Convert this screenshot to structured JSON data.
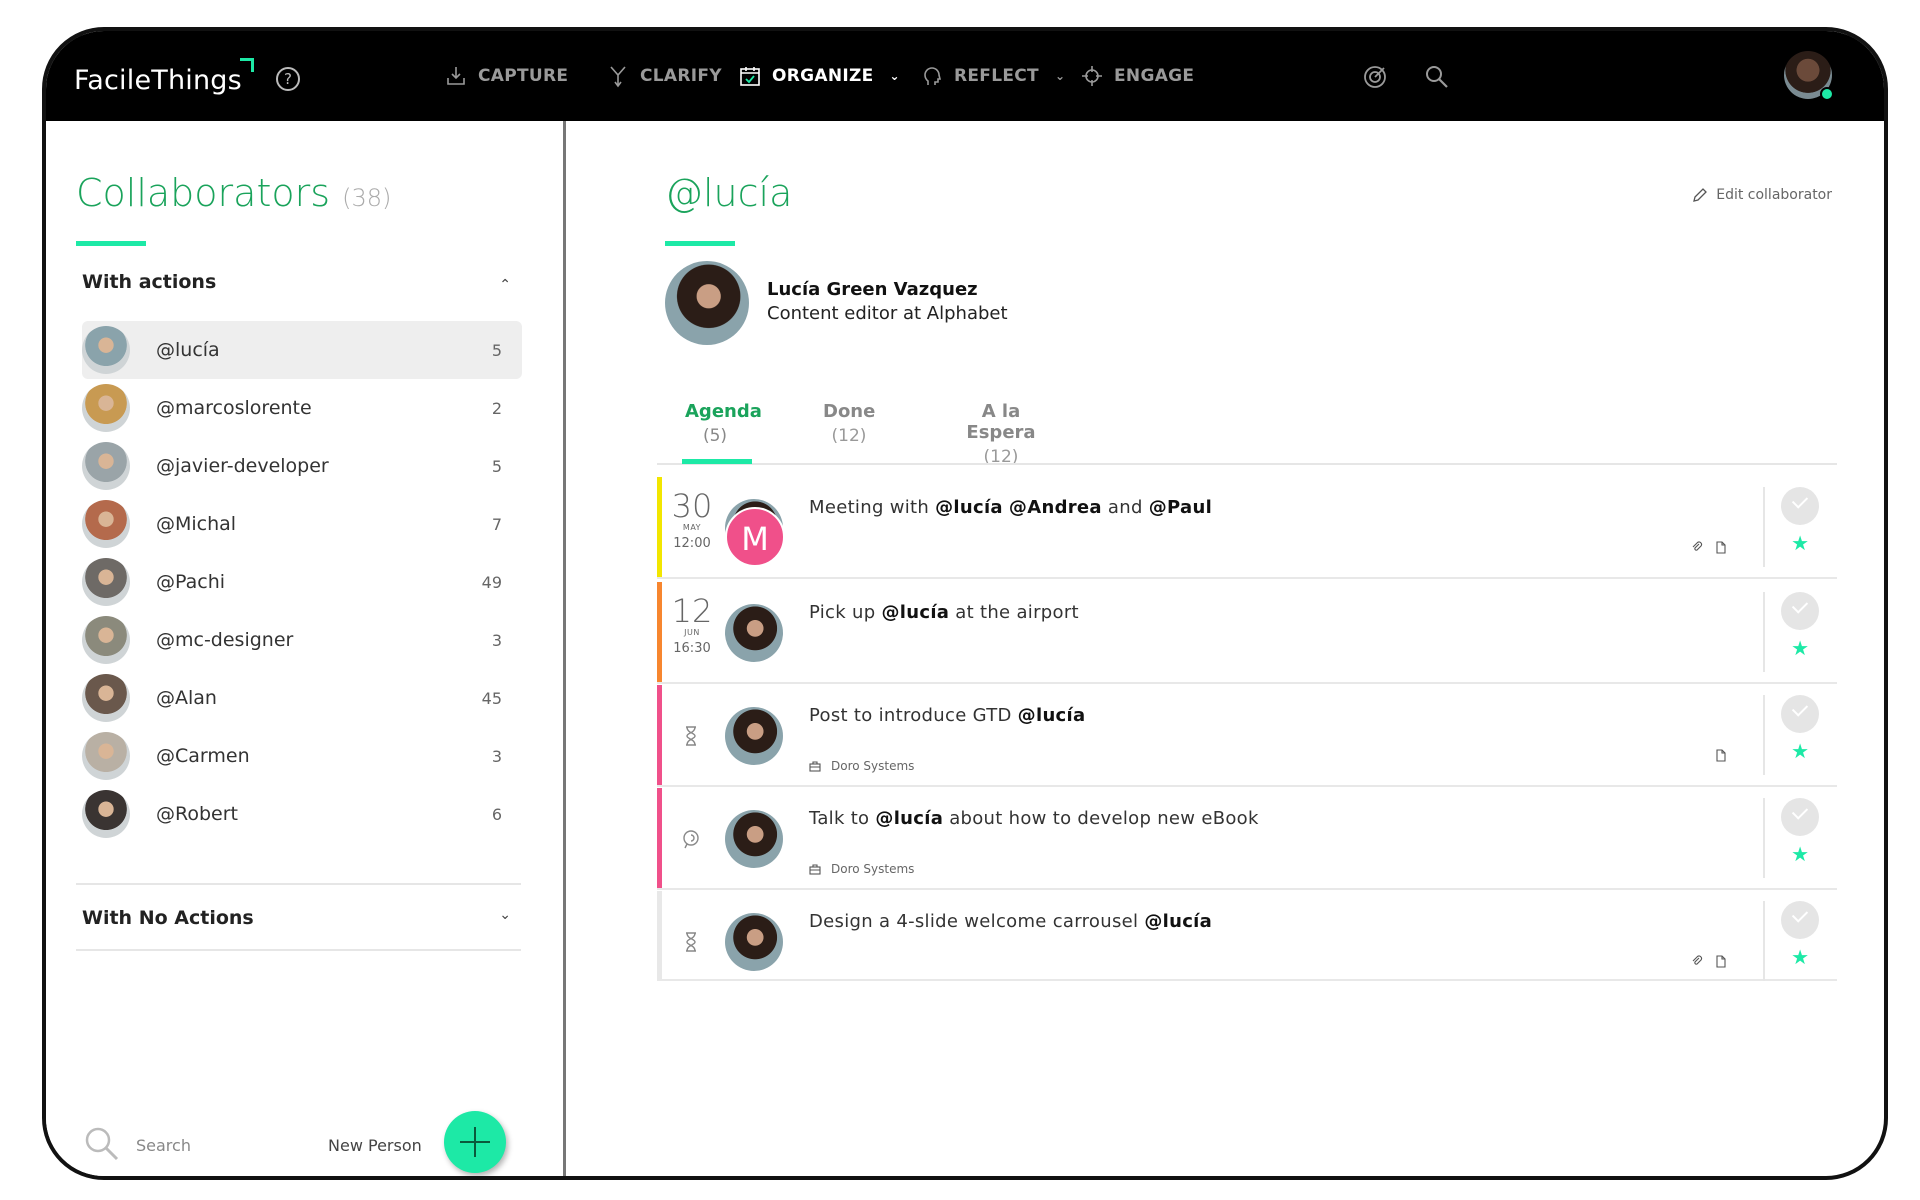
{
  "app": {
    "logo": "FacileThings"
  },
  "nav": [
    {
      "label": "CAPTURE",
      "icon": "inbox-download-icon",
      "active": false
    },
    {
      "label": "CLARIFY",
      "icon": "clarify-fork-icon",
      "active": false
    },
    {
      "label": "ORGANIZE",
      "icon": "calendar-check-icon",
      "active": true,
      "dropdown": true
    },
    {
      "label": "REFLECT",
      "icon": "head-icon",
      "active": false,
      "dropdown": true
    },
    {
      "label": "ENGAGE",
      "icon": "crosshair-icon",
      "active": false
    }
  ],
  "left": {
    "title": "Collaborators",
    "count": "(38)",
    "section_with_actions": "With actions",
    "section_no_actions": "With No Actions",
    "people": [
      {
        "name": "@lucía",
        "count": "5",
        "selected": true,
        "color": "#8aa3ab"
      },
      {
        "name": "@marcoslorente",
        "count": "2",
        "color": "#c89a52"
      },
      {
        "name": "@javier-developer",
        "count": "5",
        "color": "#9aa4a8"
      },
      {
        "name": "@Michal",
        "count": "7",
        "color": "#b46a4c"
      },
      {
        "name": "@Pachi",
        "count": "49",
        "color": "#6e6a66"
      },
      {
        "name": "@mc-designer",
        "count": "3",
        "color": "#8b8a7c"
      },
      {
        "name": "@Alan",
        "count": "45",
        "color": "#6a584c"
      },
      {
        "name": "@Carmen",
        "count": "3",
        "color": "#b9b0a4"
      },
      {
        "name": "@Robert",
        "count": "6",
        "color": "#3a3432"
      }
    ],
    "search_label": "Search",
    "new_person_label": "New Person"
  },
  "main": {
    "handle": "@lucía",
    "edit_label": "Edit collaborator",
    "profile_name": "Lucía Green Vazquez",
    "profile_role": "Content editor at Alphabet",
    "tabs": [
      {
        "label": "Agenda",
        "count": "(5)",
        "active": true
      },
      {
        "label": "Done",
        "count": "(12)"
      },
      {
        "label": "A la Espera",
        "count": "(12)"
      }
    ],
    "tasks": [
      {
        "bar_color": "#f2e600",
        "day": "30",
        "month": "MAY",
        "time": "12:00",
        "badge": "M",
        "text": [
          {
            "t": "Meeting with "
          },
          {
            "b": "@lucía"
          },
          {
            "t": " "
          },
          {
            "b": "@Andrea"
          },
          {
            "t": " and "
          },
          {
            "b": "@Paul"
          }
        ],
        "project": "",
        "clip": true,
        "doc": true
      },
      {
        "bar_color": "#f7862f",
        "day": "12",
        "month": "JUN",
        "time": "16:30",
        "text": [
          {
            "t": "Pick up "
          },
          {
            "b": "@lucía"
          },
          {
            "t": " at the airport"
          }
        ],
        "project": "",
        "clip": false,
        "doc": false
      },
      {
        "bar_color": "#f0508a",
        "status": "hourglass-icon",
        "text": [
          {
            "t": "Post to introduce GTD "
          },
          {
            "b": "@lucía"
          }
        ],
        "project": "Doro Systems",
        "clip": false,
        "doc": true
      },
      {
        "bar_color": "#f0508a",
        "status": "brain-icon",
        "text": [
          {
            "t": "Talk to "
          },
          {
            "b": "@lucía"
          },
          {
            "t": " about how to develop new eBook"
          }
        ],
        "project": "Doro Systems",
        "clip": false,
        "doc": false
      },
      {
        "bar_color": "#e8e8e8",
        "status": "hourglass-icon",
        "text": [
          {
            "t": "Design a 4-slide welcome carrousel "
          },
          {
            "b": "@lucía"
          }
        ],
        "project": "",
        "clip": true,
        "doc": true
      }
    ]
  },
  "colors": {
    "accent": "#1de9a6",
    "title_green": "#1aa35b",
    "topbar": "#000000"
  }
}
